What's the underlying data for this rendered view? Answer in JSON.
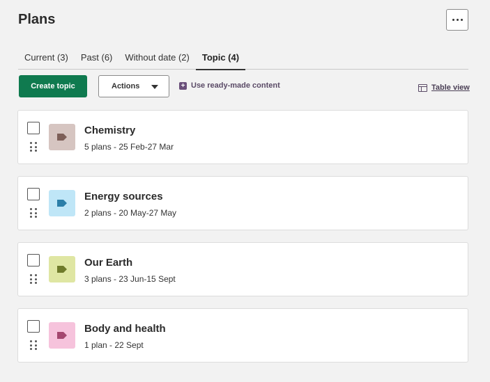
{
  "header": {
    "title": "Plans",
    "more_icon": "more-horizontal-icon"
  },
  "tabs": [
    {
      "label": "Current (3)",
      "active": false
    },
    {
      "label": "Past (6)",
      "active": false
    },
    {
      "label": "Without date (2)",
      "active": false
    },
    {
      "label": "Topic (4)",
      "active": true
    }
  ],
  "toolbar": {
    "create_label": "Create topic",
    "actions_label": "Actions",
    "readymade_label": "Use ready-made content",
    "tableview_label": "Table view"
  },
  "topics": [
    {
      "title": "Chemistry",
      "meta": "5 plans - 25 Feb-27 Mar",
      "tile_color": "#d6c5c1",
      "tag_color": "#7d5f58"
    },
    {
      "title": "Energy sources",
      "meta": "2 plans - 20 May-27 May",
      "tile_color": "#bfe6f7",
      "tag_color": "#2b7ea8"
    },
    {
      "title": "Our Earth",
      "meta": "3 plans - 23 Jun-15 Sept",
      "tile_color": "#dfe6a3",
      "tag_color": "#6f7a2a"
    },
    {
      "title": "Body and health",
      "meta": "1 plan - 22 Sept",
      "tile_color": "#f6c3dc",
      "tag_color": "#a4476f"
    }
  ],
  "colors": {
    "primary": "#0f7a4f",
    "accent": "#5a4a66"
  }
}
